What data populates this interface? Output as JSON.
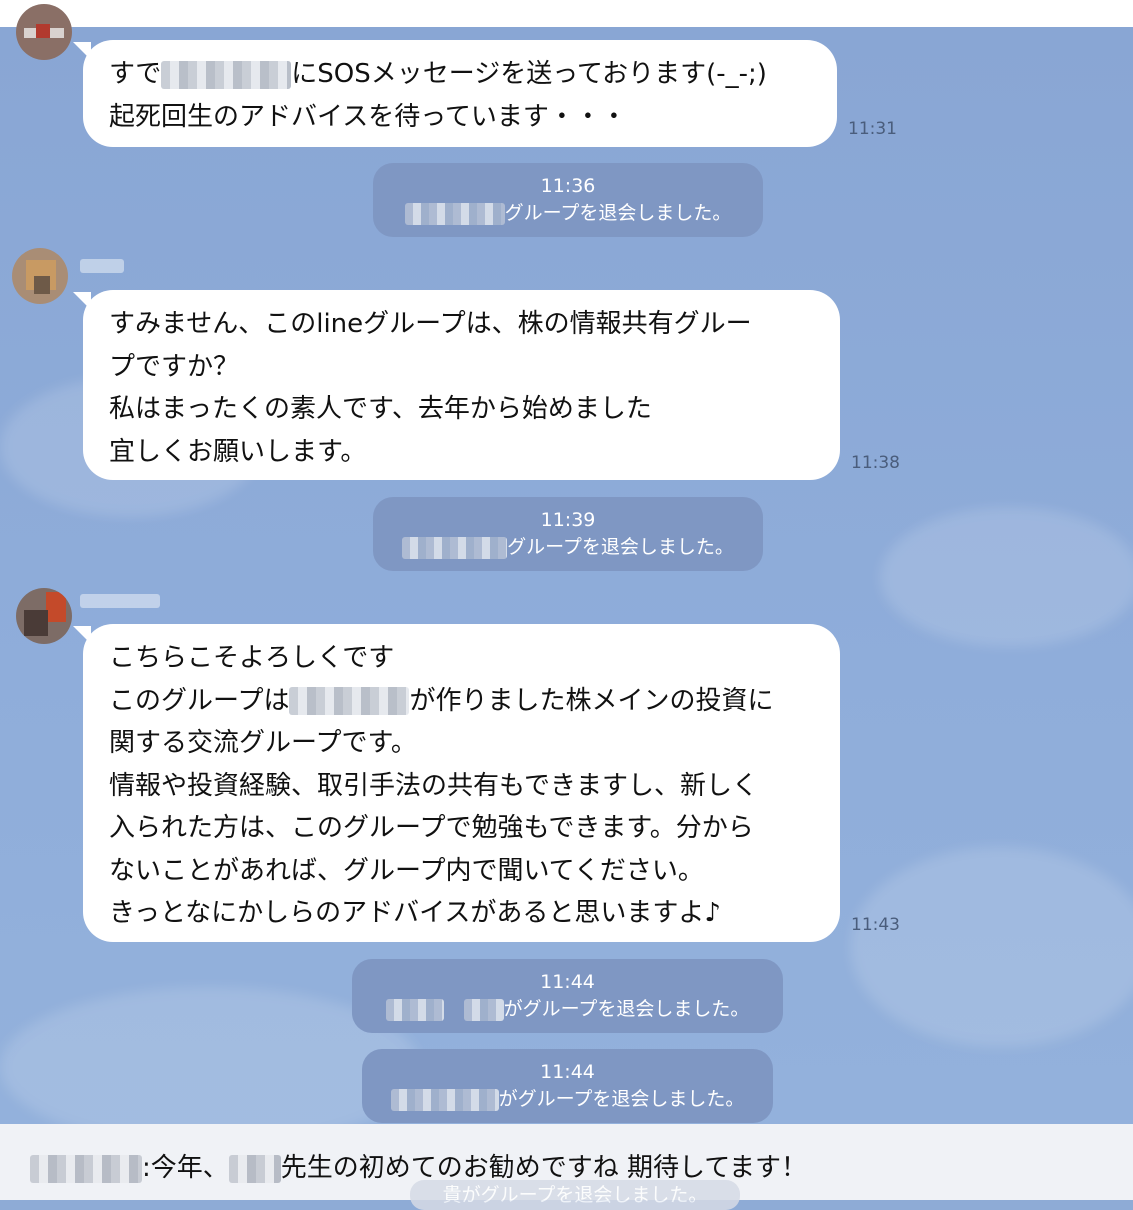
{
  "messages": [
    {
      "lines_pre": [
        "すで"
      ],
      "line1_after_blur": "にSOSメッセージを送っております(-_-;)",
      "line2": "起死回生のアドバイスを待っています・・・",
      "time": "11:31"
    },
    {
      "lines": [
        "すみません、このlineグループは、株の情報共有グルー",
        "プですか？",
        "私はまったくの素人です、去年から始めました",
        "宜しくお願いします。"
      ],
      "time": "11:38"
    },
    {
      "line1": "こちらこそよろしくです",
      "line2_before": "このグループは",
      "line2_after": "が作りました株メインの投資に",
      "lines_rest": [
        "関する交流グループです。",
        "情報や投資経験、取引手法の共有もできますし、新しく",
        "入られた方は、このグループで勉強もできます。分から",
        "ないことがあれば、グループ内で聞いてください。",
        "きっとなにかしらのアドバイスがあると思いますよ♪"
      ],
      "time": "11:43"
    }
  ],
  "system_events": [
    {
      "time": "11:36",
      "text": "グループを退会しました。"
    },
    {
      "time": "11:39",
      "text": "グループを退会しました。"
    },
    {
      "time": "11:44",
      "text": "がグループを退会しました。"
    },
    {
      "time": "11:44",
      "text": "がグループを退会しました。"
    }
  ],
  "notice": {
    "text_mid": ":今年、",
    "text_end": "先生の初めてのお勧めですね 期待してます！",
    "ghost_text": "貴がグループを退会しました。"
  },
  "colors": {
    "background": "#8eabd6",
    "bubble": "#ffffff",
    "system_pill": "#7f97c3",
    "notice_bar": "#f0f2f6"
  }
}
